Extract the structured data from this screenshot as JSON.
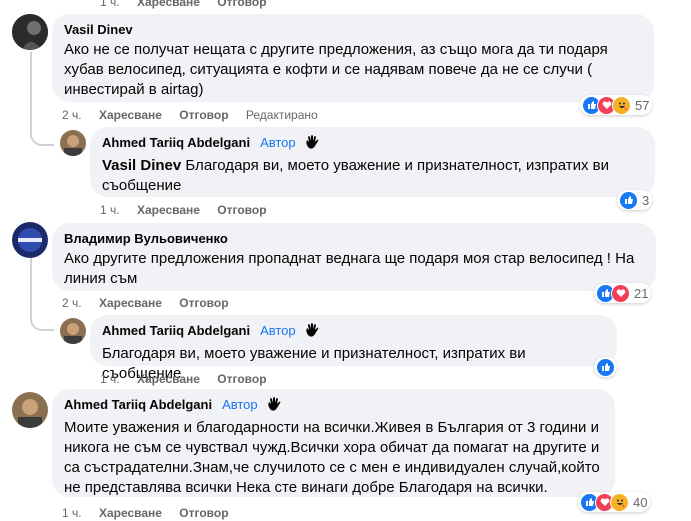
{
  "top_actions": {
    "time": "1 ч.",
    "like": "Харесване",
    "reply": "Отговор"
  },
  "comments": [
    {
      "name": "Vasil Dinev",
      "text": "Ако не се получат нещата с другите предложения, аз също мога да ти подаря хубав велосипед, ситуацията е кофти и се надявам повече да не се случи ( инвестирай в airtag)",
      "time": "2 ч.",
      "like": "Харесване",
      "reply": "Отговор",
      "edited": "Редактирано",
      "reaction_count": "57",
      "reactions": [
        "like-icon",
        "love-icon",
        "haha-icon"
      ]
    },
    {
      "name": "Ahmed Tariiq Abdelgani",
      "badge": "Автор",
      "mention": "Vasil Dinev",
      "text": " Благодаря ви, моето уважение и признателност, изпратих ви съобщение",
      "time": "1 ч.",
      "like": "Харесване",
      "reply": "Отговор",
      "reaction_count": "3",
      "reactions": [
        "like-icon"
      ]
    },
    {
      "name": "Владимир Вульовиченко",
      "text": "Ако другите предложения пропаднат веднага ще подаря моя стар велосипед ! На линия съм",
      "time": "2 ч.",
      "like": "Харесване",
      "reply": "Отговор",
      "reaction_count": "21",
      "reactions": [
        "like-icon",
        "love-icon"
      ]
    },
    {
      "name": "Ahmed Tariiq Abdelgani",
      "badge": "Автор",
      "text": "Благодаря ви, моето уважение и признателност, изпратих ви съобщение",
      "time": "1 ч.",
      "like": "Харесване",
      "reply": "Отговор",
      "reactions": [
        "like-icon"
      ]
    },
    {
      "name": "Ahmed Tariiq Abdelgani",
      "badge": "Автор",
      "text": "Моите уважения и благодарности на всички.Живея в България от 3 години и никога не съм се чувствал чужд.Всички хора обичат да помагат на другите и са състрадателни.Знам,че случилото се с мен е индивидуален случай,който не представлява всички Нека сте винаги добре Благодаря на всички.",
      "time": "1 ч.",
      "like": "Харесване",
      "reply": "Отговор",
      "reaction_count": "40",
      "reactions": [
        "like-icon",
        "love-icon",
        "haha-icon"
      ]
    }
  ],
  "colors": {
    "like": "#1877f2",
    "love": "#f33e58",
    "haha": "#f7b125",
    "author": "#1877f2",
    "bubble": "#f0f2f5"
  }
}
